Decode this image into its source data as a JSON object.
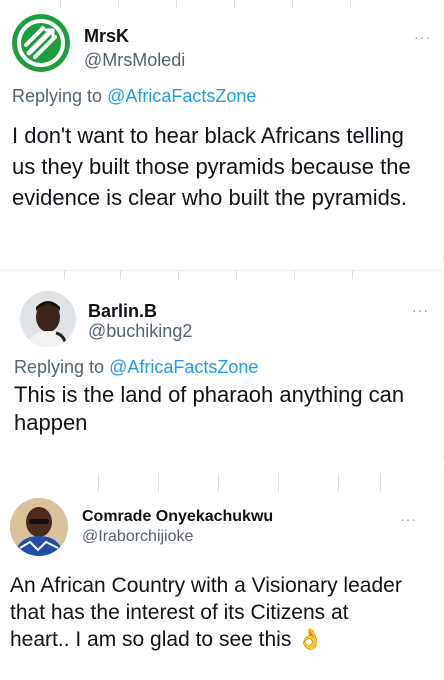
{
  "tweets": [
    {
      "name": "MrsK",
      "handle": "@MrsMoledi",
      "replying_prefix": "Replying to ",
      "replying_to": "@AfricaFactsZone",
      "text": "I don't want to hear black Africans telling us they built those pyramids because the evidence is clear who built the pyramids.",
      "more_label": "···",
      "avatar": "green-logo-avatar"
    },
    {
      "name": "Barlin.B",
      "handle": "@buchiking2",
      "replying_prefix": "Replying to ",
      "replying_to": "@AfricaFactsZone",
      "text": "This is the land of pharaoh anything can happen",
      "more_label": "···",
      "avatar": "profile-photo-avatar"
    },
    {
      "name": "Comrade Onyekachukwu",
      "handle": "@Iraborchijioke",
      "text": "An African Country with a Visionary leader that has the interest of its Citizens at heart.. I am so glad to see this",
      "emoji": "👌",
      "more_label": "···",
      "avatar": "profile-photo-avatar"
    }
  ],
  "colors": {
    "link": "#1d9bf0",
    "text": "#0f1419",
    "muted": "#536471",
    "divider": "#e6ecf0",
    "logo_green": "#1e9e3e"
  }
}
